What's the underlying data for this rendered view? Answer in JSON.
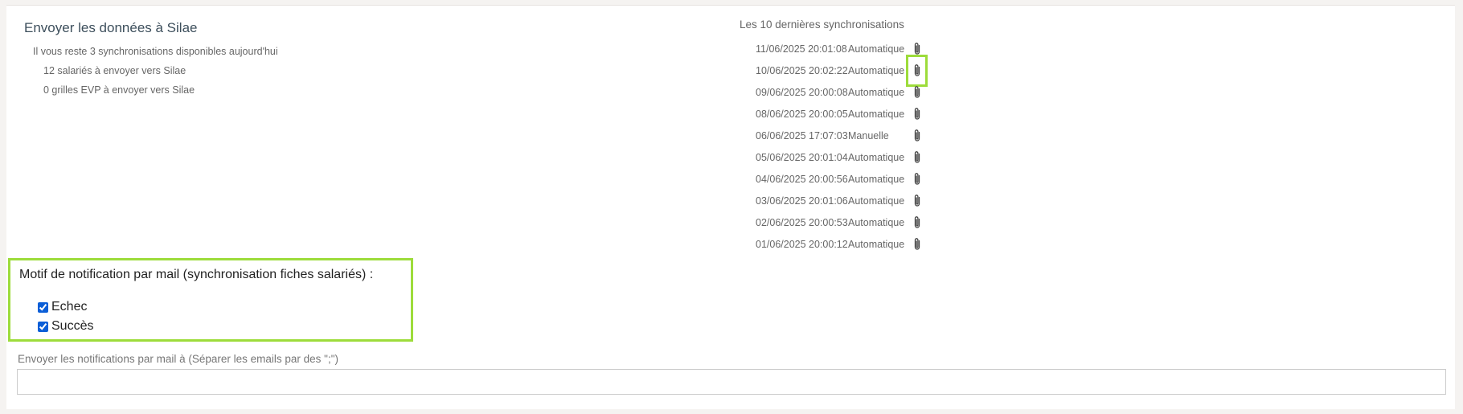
{
  "send_section": {
    "title": "Envoyer les données à Silae",
    "remaining": "Il vous reste 3 synchronisations disponibles aujourd'hui",
    "employees_count": "12 salariés à envoyer vers Silae",
    "evp_count": "0 grilles EVP à envoyer vers Silae"
  },
  "sync_history": {
    "heading": "Les 10 dernières synchronisations",
    "items": [
      {
        "date": "11/06/2025 20:01:08",
        "type": "Automatique",
        "icon": "paperclip-icon"
      },
      {
        "date": "10/06/2025 20:02:22",
        "type": "Automatique",
        "icon": "paperclip-icon"
      },
      {
        "date": "09/06/2025 20:00:08",
        "type": "Automatique",
        "icon": "paperclip-icon"
      },
      {
        "date": "08/06/2025 20:00:05",
        "type": "Automatique",
        "icon": "paperclip-icon"
      },
      {
        "date": "06/06/2025 17:07:03",
        "type": "Manuelle",
        "icon": "paperclip-icon"
      },
      {
        "date": "05/06/2025 20:01:04",
        "type": "Automatique",
        "icon": "paperclip-icon"
      },
      {
        "date": "04/06/2025 20:00:56",
        "type": "Automatique",
        "icon": "paperclip-icon"
      },
      {
        "date": "03/06/2025 20:01:06",
        "type": "Automatique",
        "icon": "paperclip-icon"
      },
      {
        "date": "02/06/2025 20:00:53",
        "type": "Automatique",
        "icon": "paperclip-icon"
      },
      {
        "date": "01/06/2025 20:00:12",
        "type": "Automatique",
        "icon": "paperclip-icon"
      }
    ]
  },
  "notification": {
    "title": "Motif de notification par mail (synchronisation fiches salariés) :",
    "options": [
      {
        "label": "Echec",
        "checked": true
      },
      {
        "label": "Succès",
        "checked": true
      }
    ]
  },
  "email": {
    "label": "Envoyer les notifications par mail à (Séparer les emails par des \";\")",
    "value": "",
    "placeholder": ""
  },
  "colors": {
    "highlight": "#9ddc3b",
    "title": "#3d4f5c",
    "checkbox": "#0b5ed7"
  }
}
